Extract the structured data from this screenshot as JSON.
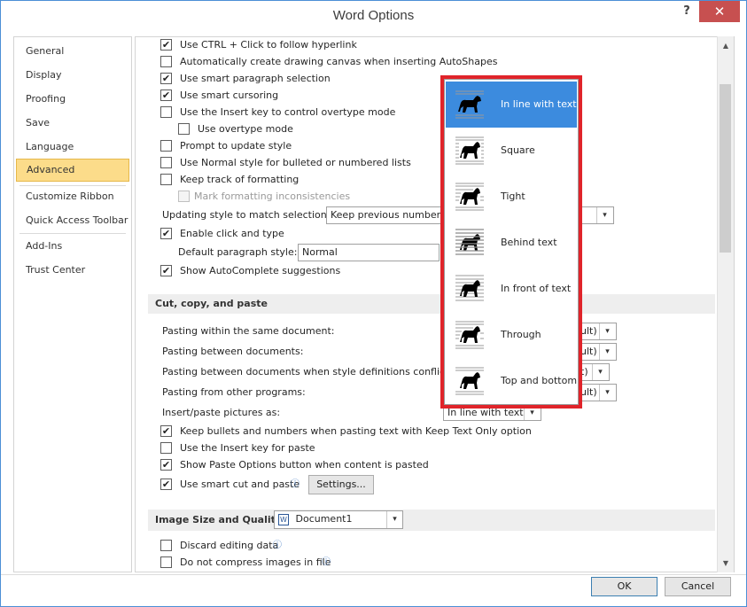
{
  "window": {
    "title": "Word Options",
    "help": "?",
    "close": "✕"
  },
  "sidebar": {
    "items": [
      {
        "label": "General"
      },
      {
        "label": "Display"
      },
      {
        "label": "Proofing"
      },
      {
        "label": "Save"
      },
      {
        "label": "Language"
      },
      {
        "label": "Advanced"
      },
      {
        "label": "Customize Ribbon"
      },
      {
        "label": "Quick Access Toolbar"
      },
      {
        "label": "Add-Ins"
      },
      {
        "label": "Trust Center"
      }
    ]
  },
  "editing": {
    "opts": [
      {
        "label": "Use CTRL + Click to follow hyperlink",
        "checked": true
      },
      {
        "label": "Automatically create drawing canvas when inserting AutoShapes",
        "checked": false
      },
      {
        "label": "Use smart paragraph selection",
        "checked": true
      },
      {
        "label": "Use smart cursoring",
        "checked": true
      },
      {
        "label": "Use the Insert key to control overtype mode",
        "checked": false
      },
      {
        "label": "Use overtype mode",
        "checked": false
      },
      {
        "label": "Prompt to update style",
        "checked": false
      },
      {
        "label": "Use Normal style for bulleted or numbered lists",
        "checked": false
      },
      {
        "label": "Keep track of formatting",
        "checked": false
      },
      {
        "label": "Mark formatting inconsistencies",
        "checked": false,
        "disabled": true
      }
    ],
    "updating_style_label": "Updating style to match selection:",
    "updating_style_value": "Keep previous numbering",
    "click_type": {
      "label": "Enable click and type",
      "checked": true
    },
    "default_para_label": "Default paragraph style:",
    "default_para_value": "Normal",
    "autocomplete": {
      "label": "Show AutoComplete suggestions",
      "checked": true
    }
  },
  "cut_copy_paste": {
    "header": "Cut, copy, and paste",
    "rows": [
      {
        "label": "Pasting within the same document:",
        "value": "ult)"
      },
      {
        "label": "Pasting between documents:",
        "value": "ult)"
      },
      {
        "label": "Pasting between documents when style definitions conflict:",
        "value": "t)"
      },
      {
        "label": "Pasting from other programs:",
        "value": "ult)"
      }
    ],
    "insert_pictures_label": "Insert/paste pictures as:",
    "insert_pictures_value": "In line with text",
    "opts": [
      {
        "label": "Keep bullets and numbers when pasting text with Keep Text Only option",
        "checked": true
      },
      {
        "label": "Use the Insert key for paste",
        "checked": false
      },
      {
        "label": "Show Paste Options button when content is pasted",
        "checked": true
      },
      {
        "label": "Use smart cut and paste",
        "checked": true
      }
    ],
    "settings_button": "Settings..."
  },
  "image_size": {
    "header": "Image Size and Quality",
    "document": "Document1",
    "opts": [
      {
        "label": "Discard editing data",
        "checked": false
      },
      {
        "label": "Do not compress images in file",
        "checked": false
      }
    ]
  },
  "wrap_popup": {
    "items": [
      {
        "label": "In line with text",
        "icon": "inline-wrap-icon"
      },
      {
        "label": "Square",
        "icon": "square-wrap-icon"
      },
      {
        "label": "Tight",
        "icon": "tight-wrap-icon"
      },
      {
        "label": "Behind text",
        "icon": "behind-text-icon"
      },
      {
        "label": "In front of text",
        "icon": "in-front-text-icon"
      },
      {
        "label": "Through",
        "icon": "through-wrap-icon"
      },
      {
        "label": "Top and bottom",
        "icon": "top-bottom-wrap-icon"
      }
    ]
  },
  "footer": {
    "ok": "OK",
    "cancel": "Cancel"
  },
  "colors": {
    "highlight_frame": "#e0242a",
    "selected_item": "#3c8bde",
    "active_sidebar": "#fcdc8a"
  }
}
